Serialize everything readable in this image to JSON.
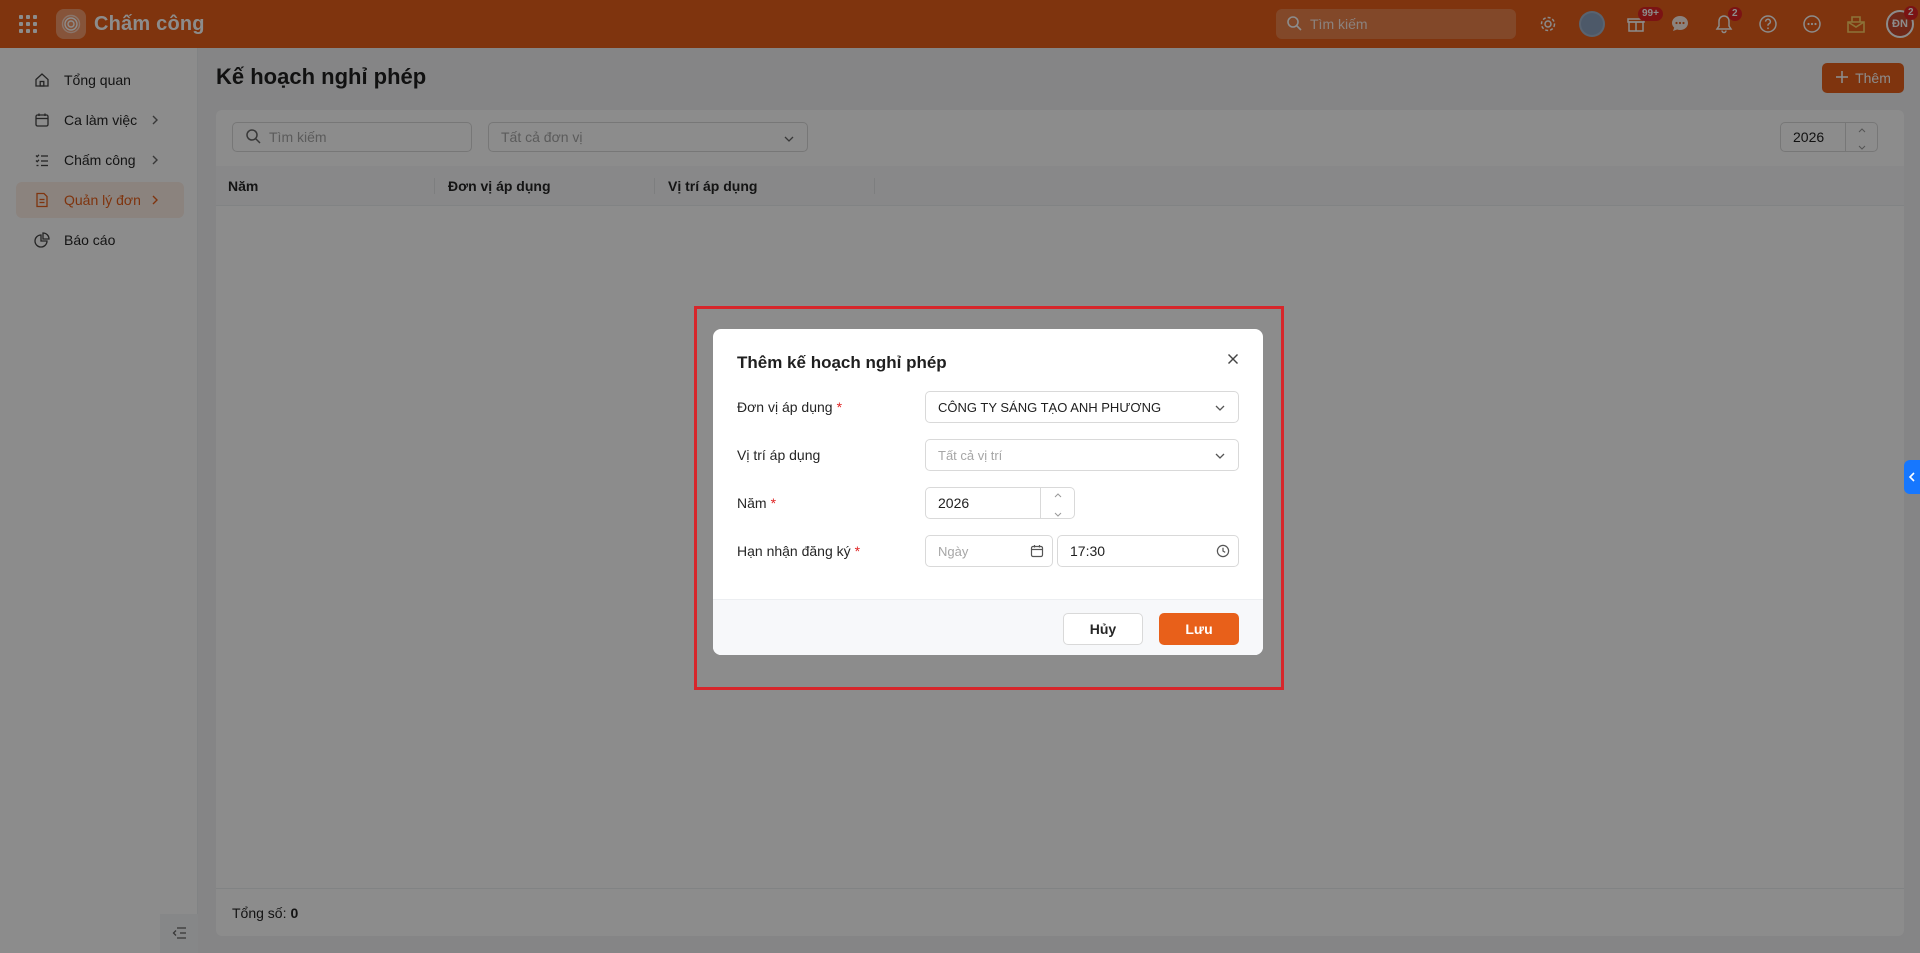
{
  "app": {
    "title": "Chấm công"
  },
  "topbar": {
    "search_placeholder": "Tìm kiếm",
    "badges": {
      "apps": "99+",
      "notifications": "2",
      "avatar": "2"
    },
    "avatar_initials": "ĐN",
    "icons": [
      "apps-grid-icon",
      "gear-icon",
      "user-avatar",
      "gift-icon",
      "chat-icon",
      "bell-icon",
      "help-icon",
      "more-icon",
      "gift-box-icon"
    ]
  },
  "sidebar": {
    "items": [
      {
        "label": "Tổng quan",
        "icon": "home-icon",
        "has_children": false,
        "active": false
      },
      {
        "label": "Ca làm việc",
        "icon": "calendar-icon",
        "has_children": true,
        "active": false
      },
      {
        "label": "Chấm công",
        "icon": "checklist-icon",
        "has_children": true,
        "active": false
      },
      {
        "label": "Quản lý đơn",
        "icon": "document-icon",
        "has_children": true,
        "active": true
      },
      {
        "label": "Báo cáo",
        "icon": "pie-chart-icon",
        "has_children": false,
        "active": false
      }
    ]
  },
  "page": {
    "title": "Kế hoạch nghỉ phép",
    "add_label": "Thêm",
    "filters": {
      "search_placeholder": "Tìm kiếm",
      "unit_placeholder": "Tất cả đơn vị",
      "year_value": "2026"
    },
    "table": {
      "columns": [
        "Năm",
        "Đơn vị áp dụng",
        "Vị trí áp dụng"
      ],
      "rows": []
    },
    "footer": {
      "total_label": "Tổng số:",
      "total_value": "0"
    }
  },
  "modal": {
    "title": "Thêm kế hoạch nghỉ phép",
    "fields": {
      "unit": {
        "label": "Đơn vị áp dụng",
        "required": true,
        "value": "CÔNG TY SÁNG TẠO ANH PHƯƠNG"
      },
      "position": {
        "label": "Vị trí áp dụng",
        "required": false,
        "placeholder": "Tất cả vị trí"
      },
      "year": {
        "label": "Năm",
        "required": true,
        "value": "2026"
      },
      "deadline": {
        "label": "Hạn nhận đăng ký",
        "required": true,
        "date_placeholder": "Ngày",
        "time_value": "17:30"
      }
    },
    "cancel_label": "Hủy",
    "save_label": "Lưu"
  },
  "colors": {
    "brand": "#e8601a",
    "highlight": "#d7262b",
    "badge": "#e02424"
  }
}
